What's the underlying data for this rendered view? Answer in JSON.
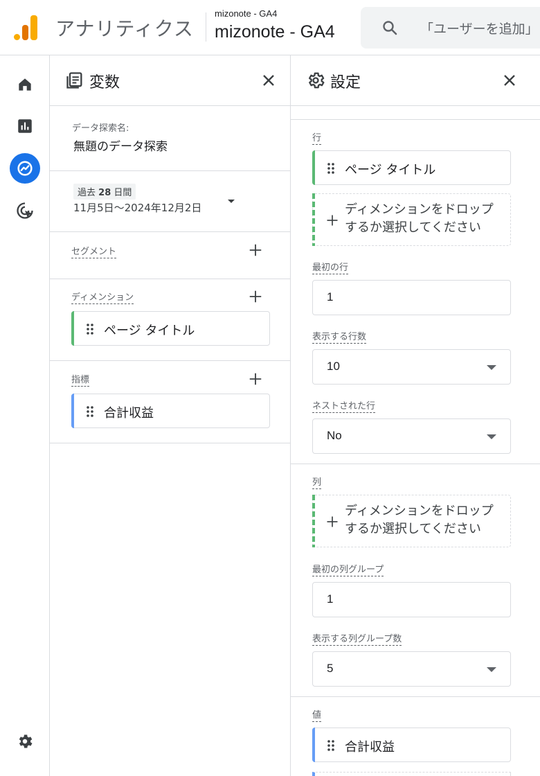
{
  "topbar": {
    "app_title": "アナリティクス",
    "property_account": "mizonote - GA4",
    "property_name": "mizonote - GA4",
    "search_placeholder": "「ユーザーを追加」"
  },
  "leftnav": {
    "items": [
      {
        "name": "home",
        "icon": "home-icon",
        "active": false
      },
      {
        "name": "reports",
        "icon": "bar-chart-icon",
        "active": false
      },
      {
        "name": "explore",
        "icon": "explore-icon",
        "active": true
      },
      {
        "name": "advertising",
        "icon": "target-cursor-icon",
        "active": false
      },
      {
        "name": "admin",
        "icon": "gear-icon",
        "active": false
      }
    ]
  },
  "variables": {
    "title": "変数",
    "exploration_name_label": "データ探索名:",
    "exploration_name": "無題のデータ探索",
    "date_range": {
      "prefix": "過去",
      "days": "28",
      "suffix": "日間",
      "range": "11月5日〜2024年12月2日"
    },
    "segments_label": "セグメント",
    "dimensions_label": "ディメンション",
    "dimensions": [
      "ページ タイトル"
    ],
    "metrics_label": "指標",
    "metrics": [
      "合計収益"
    ]
  },
  "settings": {
    "title": "設定",
    "rows_label": "行",
    "rows_chip": "ページ タイトル",
    "drop_line1": "ディメンションをドロップ",
    "drop_line2": "するか選択してください",
    "first_row_label": "最初の行",
    "first_row_value": "1",
    "show_rows_label": "表示する行数",
    "show_rows_value": "10",
    "nested_rows_label": "ネストされた行",
    "nested_rows_value": "No",
    "columns_label": "列",
    "first_col_group_label": "最初の列グループ",
    "first_col_group_value": "1",
    "show_col_groups_label": "表示する列グループ数",
    "show_col_groups_value": "5",
    "values_label": "値",
    "values_chip": "合計収益"
  },
  "colors": {
    "accent": "#1a73e8",
    "dimension": "#5bb974",
    "metric": "#669df6",
    "logo_light": "#f9ab00",
    "logo_dark": "#e37400"
  }
}
